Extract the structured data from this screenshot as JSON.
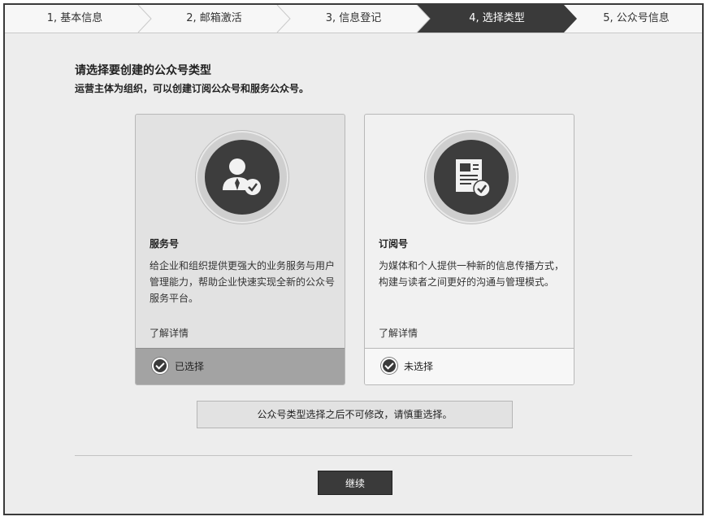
{
  "steps": [
    {
      "label": "1, 基本信息",
      "active": false
    },
    {
      "label": "2, 邮箱激活",
      "active": false
    },
    {
      "label": "3, 信息登记",
      "active": false
    },
    {
      "label": "4, 选择类型",
      "active": true
    },
    {
      "label": "5, 公众号信息",
      "active": false
    }
  ],
  "header": {
    "title": "请选择要创建的公众号类型",
    "subtitle": "运营主体为组织，可以创建订阅公众号和服务公众号。"
  },
  "cards": [
    {
      "icon": "service-user-icon",
      "title": "服务号",
      "description": "给企业和组织提供更强大的业务服务与用户管理能力，帮助企业快速实现全新的公众号服务平台。",
      "link": "了解详情",
      "status": "已选择",
      "selected": true
    },
    {
      "icon": "subscription-document-icon",
      "title": "订阅号",
      "description": "为媒体和个人提供一种新的信息传播方式，构建与读者之间更好的沟通与管理模式。",
      "link": "了解详情",
      "status": "未选择",
      "selected": false
    }
  ],
  "notice": "公众号类型选择之后不可修改，请慎重选择。",
  "continue_label": "继续",
  "colors": {
    "active_step": "#3a3a3a",
    "selected_foot": "#a3a3a3",
    "icon_circle": "#3d3d3d"
  }
}
